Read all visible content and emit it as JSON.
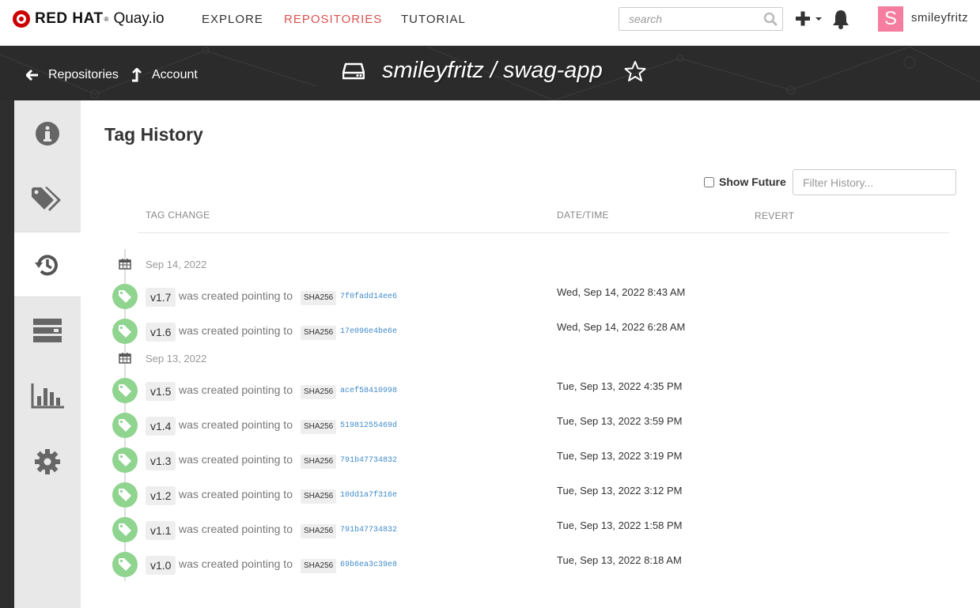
{
  "navbar": {
    "brand_redhat": "RED HAT",
    "brand_tm": "®",
    "brand_product": "Quay.io",
    "links": {
      "explore": "EXPLORE",
      "repositories": "REPOSITORIES",
      "tutorial": "TUTORIAL"
    },
    "search_placeholder": "search",
    "avatar_letter": "S",
    "username": "smileyfritz",
    "active_color": "#d9534f",
    "avatar_color": "#f57da0"
  },
  "header": {
    "breadcrumb_repositories": "Repositories",
    "breadcrumb_account": "Account",
    "repo_namespace": "smileyfritz",
    "repo_separator": "/",
    "repo_name": "swag-app"
  },
  "sidebar": {
    "tabs": [
      {
        "icon": "info-icon"
      },
      {
        "icon": "tags-icon"
      },
      {
        "icon": "history-icon",
        "active": true
      },
      {
        "icon": "builds-icon"
      },
      {
        "icon": "usage-chart-icon"
      },
      {
        "icon": "settings-gear-icon"
      }
    ]
  },
  "main": {
    "title": "Tag History",
    "show_future_label": "Show Future",
    "filter_placeholder": "Filter History...",
    "columns": {
      "tag_change": "TAG CHANGE",
      "date_time": "DATE/TIME",
      "revert": "REVERT"
    },
    "created_text": "was created pointing to",
    "sha_label": "SHA256",
    "tag_color": "#8fd48f",
    "groups": [
      {
        "date": "Sep 14, 2022",
        "entries": [
          {
            "tag": "v1.7",
            "sha": "7f0fadd14ee6",
            "datetime": "Wed, Sep 14, 2022 8:43 AM"
          },
          {
            "tag": "v1.6",
            "sha": "17e096e4be6e",
            "datetime": "Wed, Sep 14, 2022 6:28 AM"
          }
        ]
      },
      {
        "date": "Sep 13, 2022",
        "entries": [
          {
            "tag": "v1.5",
            "sha": "acef58410998",
            "datetime": "Tue, Sep 13, 2022 4:35 PM"
          },
          {
            "tag": "v1.4",
            "sha": "51981255469d",
            "datetime": "Tue, Sep 13, 2022 3:59 PM"
          },
          {
            "tag": "v1.3",
            "sha": "791b47734832",
            "datetime": "Tue, Sep 13, 2022 3:19 PM"
          },
          {
            "tag": "v1.2",
            "sha": "10dd1a7f316e",
            "datetime": "Tue, Sep 13, 2022 3:12 PM"
          },
          {
            "tag": "v1.1",
            "sha": "791b47734832",
            "datetime": "Tue, Sep 13, 2022 1:58 PM"
          },
          {
            "tag": "v1.0",
            "sha": "69b6ea3c39e8",
            "datetime": "Tue, Sep 13, 2022 8:18 AM"
          }
        ]
      }
    ]
  }
}
